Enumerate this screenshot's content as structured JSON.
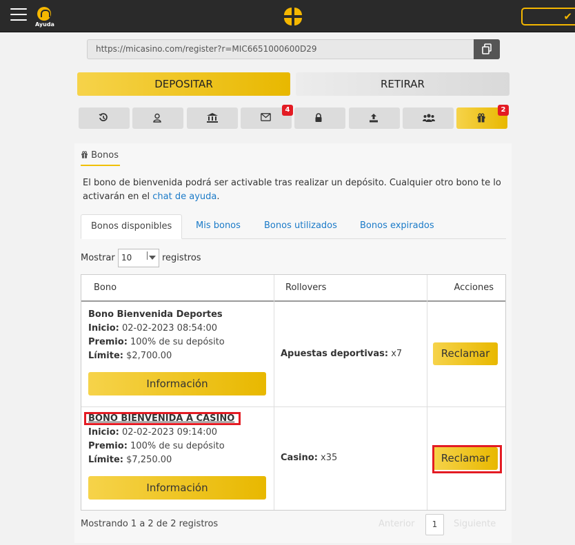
{
  "topbar": {
    "help_label": "Ayuda"
  },
  "referral": {
    "url": "https://micasino.com/register?r=MIC6651000600D29"
  },
  "actions": {
    "deposit": "DEPOSITAR",
    "withdraw": "RETIRAR"
  },
  "icon_tabs": {
    "messages_badge": "4",
    "bonus_badge": "2"
  },
  "section": {
    "title": "Bonos",
    "intro_text": "El bono de bienvenida podrá ser activable tras realizar un depósito. Cualquier otro bono te lo activarán en el ",
    "intro_link": "chat de ayuda",
    "intro_end": "."
  },
  "tabs": [
    "Bonos disponibles",
    "Mis bonos",
    "Bonos utilizados",
    "Bonos expirados"
  ],
  "length_menu": {
    "prefix": "Mostrar",
    "value": "10",
    "suffix": "registros"
  },
  "table": {
    "headers": [
      "Bono",
      "Rollovers",
      "Acciones"
    ],
    "rows": [
      {
        "title": "Bono Bienvenida Deportes",
        "inicio_label": "Inicio:",
        "inicio": "02-02-2023 08:54:00",
        "premio_label": "Premio:",
        "premio": "100% de su depósito",
        "limite_label": "Límite:",
        "limite": "$2,700.00",
        "info_button": "Información",
        "rollover_label": "Apuestas deportivas:",
        "rollover_value": "x7",
        "action_button": "Reclamar"
      },
      {
        "title": "BONO BIENVENIDA A CASINO",
        "inicio_label": "Inicio:",
        "inicio": "02-02-2023 09:14:00",
        "premio_label": "Premio:",
        "premio": "100% de su depósito",
        "limite_label": "Límite:",
        "limite": "$7,250.00",
        "info_button": "Información",
        "rollover_label": "Casino:",
        "rollover_value": "x35",
        "action_button": "Reclamar"
      }
    ]
  },
  "footer": {
    "info": "Mostrando 1 a 2 de 2 registros",
    "prev": "Anterior",
    "page": "1",
    "next": "Siguiente"
  },
  "colors": {
    "accent": "#f5b700",
    "highlight": "#e31b23",
    "link": "#1a7ac8"
  }
}
